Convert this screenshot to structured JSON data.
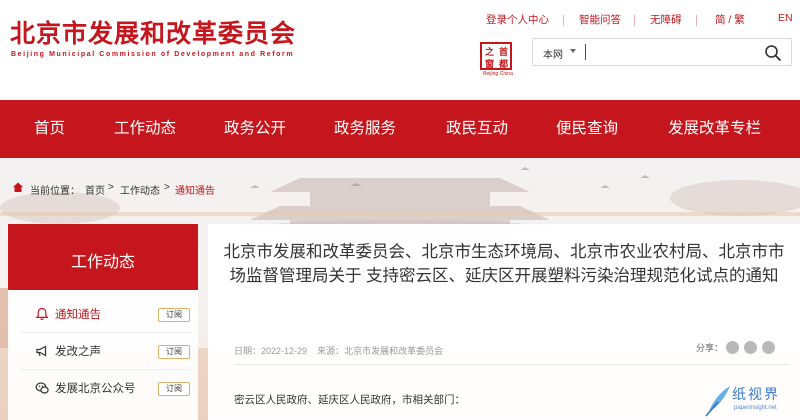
{
  "site": {
    "title": "北京市发展和改革委员会",
    "subtitle": "Beijing Municipal Commission of Development and Reform"
  },
  "top_links": {
    "login": "登录个人中心",
    "smart_qa": "智能问答",
    "accessibility": "无障碍",
    "language_cn": "简 / 繁",
    "language_en": "EN"
  },
  "logo": {
    "chars": [
      "首",
      "都",
      "之",
      "窗"
    ],
    "caption": "Beijing·China"
  },
  "search": {
    "scope": "本网",
    "value": "",
    "placeholder": ""
  },
  "nav": {
    "items": [
      "首页",
      "工作动态",
      "政务公开",
      "政务服务",
      "政民互动",
      "便民查询",
      "发展改革专栏"
    ]
  },
  "breadcrumb": {
    "label": "当前位置：",
    "items": [
      "首页",
      "工作动态",
      "通知通告"
    ],
    "separator": ">"
  },
  "sidebar": {
    "title": "工作动态",
    "items": [
      {
        "label": "通知通告",
        "badge": "订阅",
        "active": true,
        "icon": "bell-icon"
      },
      {
        "label": "发改之声",
        "badge": "订阅",
        "active": false,
        "icon": "megaphone-icon"
      },
      {
        "label": "发展北京公众号",
        "badge": "订阅",
        "active": false,
        "icon": "wechat-icon"
      }
    ]
  },
  "article": {
    "title": "北京市发展和改革委员会、北京市生态环境局、北京市农业农村局、北京市市场监督管理局关于 支持密云区、延庆区开展塑料污染治理规范化试点的通知",
    "date_label": "日期：",
    "date": "2022-12-29",
    "source_label": "来源：",
    "source": "北京市发展和改革委员会",
    "share_label": "分享：",
    "body_first_line": "密云区人民政府、延庆区人民政府，市相关部门："
  },
  "watermark": {
    "main": "纸视界",
    "sub": "paperinsight.net"
  },
  "colors": {
    "brand_red": "#c4161c",
    "badge_border": "#d9b26a"
  }
}
